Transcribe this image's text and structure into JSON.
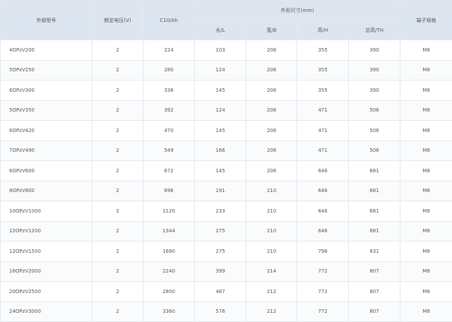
{
  "table": {
    "headers": {
      "model": "外部型号",
      "voltage": "额定电压(V)",
      "capacity": "C10/Ah",
      "dimensions": "外形尺寸(mm)",
      "length": "长/L",
      "width": "宽/B",
      "height": "高/H",
      "total_height": "总高/TH",
      "terminal": "端子规格"
    },
    "rows": [
      [
        "4OPzV200",
        "2",
        "224",
        "103",
        "206",
        "355",
        "390",
        "M8"
      ],
      [
        "5OPzV250",
        "2",
        "280",
        "124",
        "206",
        "355",
        "390",
        "M8"
      ],
      [
        "6OPzV300",
        "2",
        "336",
        "145",
        "206",
        "355",
        "390",
        "M8"
      ],
      [
        "5OPzV350",
        "2",
        "392",
        "124",
        "206",
        "471",
        "506",
        "M8"
      ],
      [
        "6OPzV420",
        "2",
        "470",
        "145",
        "206",
        "471",
        "506",
        "M8"
      ],
      [
        "7OPzV490",
        "2",
        "549",
        "166",
        "206",
        "471",
        "506",
        "M8"
      ],
      [
        "6OPzV600",
        "2",
        "672",
        "145",
        "206",
        "646",
        "681",
        "M8"
      ],
      [
        "8OPzV800",
        "2",
        "896",
        "191",
        "210",
        "646",
        "681",
        "M8"
      ],
      [
        "10OPzV1000",
        "2",
        "1120",
        "233",
        "210",
        "646",
        "681",
        "M8"
      ],
      [
        "12OPzV1200",
        "2",
        "1344",
        "275",
        "210",
        "646",
        "681",
        "M8"
      ],
      [
        "12OPzV1500",
        "2",
        "1680",
        "275",
        "210",
        "796",
        "831",
        "M8"
      ],
      [
        "16OPzV2000",
        "2",
        "2240",
        "399",
        "214",
        "772",
        "807",
        "M8"
      ],
      [
        "20OPzV2500",
        "2",
        "2800",
        "487",
        "212",
        "772",
        "807",
        "M8"
      ],
      [
        "24OPzV3000",
        "2",
        "3360",
        "576",
        "212",
        "772",
        "807",
        "M8"
      ]
    ]
  }
}
